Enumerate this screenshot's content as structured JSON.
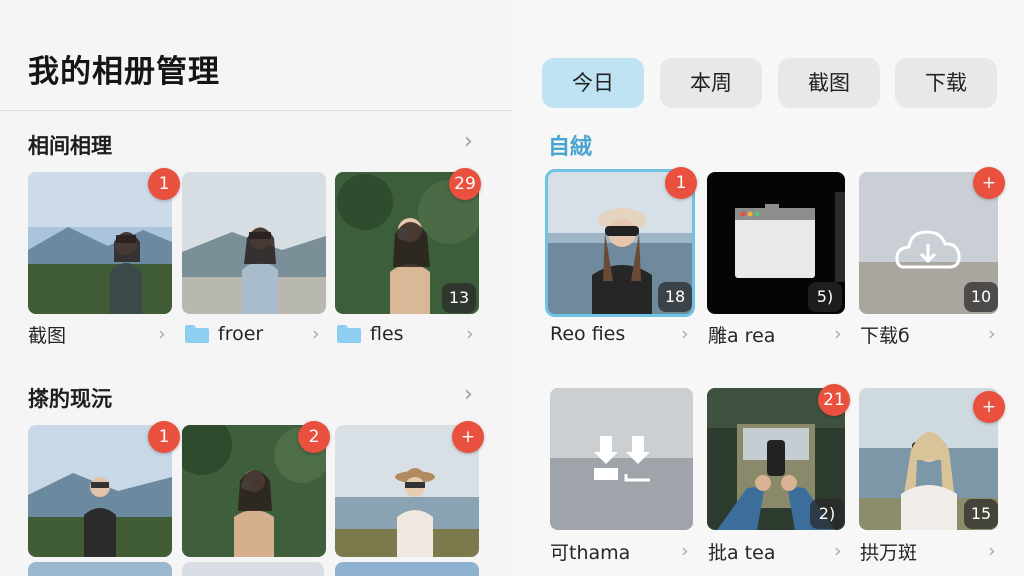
{
  "page_title": "我的相册管理",
  "tabs": [
    {
      "label": "今日",
      "active": true
    },
    {
      "label": "本周",
      "active": false
    },
    {
      "label": "截图",
      "active": false
    },
    {
      "label": "下载",
      "active": false
    }
  ],
  "left": {
    "sections": [
      {
        "title": "相间相理",
        "albums": [
          {
            "label": "截图",
            "badge": "1",
            "count": "",
            "folder_icon": false
          },
          {
            "label": "froer",
            "badge": "",
            "count": "",
            "folder_icon": true
          },
          {
            "label": "fles",
            "badge": "29",
            "count": "13",
            "folder_icon": true
          }
        ]
      },
      {
        "title": "搽肑现沅",
        "albums": [
          {
            "label": "",
            "badge": "1",
            "count": "",
            "folder_icon": false
          },
          {
            "label": "",
            "badge": "2",
            "count": "",
            "folder_icon": false
          },
          {
            "label": "",
            "badge": "+",
            "count": "",
            "folder_icon": false
          }
        ]
      }
    ]
  },
  "right": {
    "section_title": "自絨",
    "albums": [
      {
        "label": "Reo fies",
        "badge": "1",
        "count": "18",
        "selected": true
      },
      {
        "label": "雕a rea",
        "badge": "",
        "count": "5)",
        "selected": false
      },
      {
        "label": "下载б",
        "badge": "+",
        "count": "10",
        "selected": false
      },
      {
        "label": "可thama",
        "badge": "",
        "count": "",
        "selected": false
      },
      {
        "label": "批a tea",
        "badge": "21",
        "count": "2)",
        "selected": false
      },
      {
        "label": "拱万斑",
        "badge": "+",
        "count": "15",
        "selected": false
      }
    ]
  },
  "colors": {
    "accent": "#48a5cf",
    "badge": "#e9503d",
    "active_tab": "#bfe3f2"
  }
}
